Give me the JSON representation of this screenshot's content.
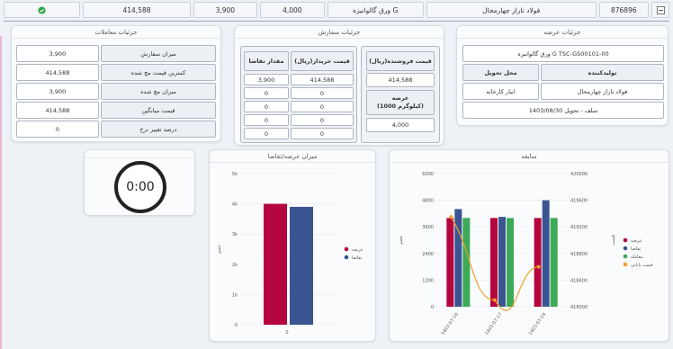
{
  "topbar": {
    "collapse_icon": "minus-box-icon",
    "code": "876896",
    "producer": "فولاد تاراز چهارمحال",
    "product": "ورق گالوانیزه G",
    "volume": "4,000",
    "qty": "3,900",
    "price": "414,588",
    "status_icon": "check-circle-icon",
    "status_color": "#28a745"
  },
  "supply": {
    "title": "جزئیات عرضه",
    "product_name": "ورق گالوانیزه G TSC-GS00101-00",
    "producer_label": "تولیدکننده",
    "delivery_label": "محل تحویل",
    "producer_value": "فولاد تاراز چهارمحال",
    "delivery_value": "انبار کارخانه",
    "settlement": "سلف - تحویل 1403/08/30"
  },
  "order": {
    "title": "جزئیات سفارش",
    "seller_price_header": "قیمت فروشنده(ریال)",
    "seller_price": "414,588",
    "supply_header": "عرضه\n(1000 کیلوگرم)",
    "supply_value": "4,000",
    "buyer_price_header": "قیمت خریدار(ریال)",
    "demand_header": "مقدار تقاضا",
    "rows": [
      {
        "price": "414,588",
        "qty": "3,900"
      },
      {
        "price": "0",
        "qty": "0"
      },
      {
        "price": "0",
        "qty": "0"
      },
      {
        "price": "0",
        "qty": "0"
      },
      {
        "price": "0",
        "qty": "0"
      }
    ]
  },
  "trades": {
    "title": "جزئیات معاملات",
    "rows": [
      {
        "label": "میزان سفارش",
        "value": "3,900"
      },
      {
        "label": "کمترین قیمت مچ شده",
        "value": "414,588"
      },
      {
        "label": "میزان مچ شده",
        "value": "3,900"
      },
      {
        "label": "قیمت میانگین",
        "value": "414,588"
      },
      {
        "label": "درصد تغییر نرخ",
        "value": "0"
      }
    ]
  },
  "timer": {
    "value": "0:00"
  },
  "supply_demand_chart": {
    "title": "میزان عرضه/تقاضا",
    "ylabel": "حجم",
    "yticks": [
      "5k",
      "4k",
      "3k",
      "2k",
      "1k",
      "0"
    ],
    "xtick": "0",
    "legend": [
      "عرضه",
      "تقاضا"
    ]
  },
  "history_chart": {
    "title": "سابقه",
    "left_ticks": [
      "6000",
      "4800",
      "3600",
      "2400",
      "1200",
      "0"
    ],
    "right_ticks": [
      "420000",
      "419600",
      "419200",
      "418800",
      "418400",
      "418000"
    ],
    "left_label": "حجم",
    "right_label": "قیمت",
    "dates": [
      "1403-07-16",
      "1403-07-17",
      "1403-07-24"
    ],
    "legend": [
      "عرضه",
      "تقاضا",
      "معامله",
      "قیمت پایانی"
    ]
  },
  "colors": {
    "supply": "#b5053f",
    "demand": "#3a5592",
    "trade": "#3daa57",
    "price": "#f0a02a"
  },
  "chart_data": [
    {
      "type": "bar",
      "title": "میزان عرضه/تقاضا",
      "ylabel": "حجم",
      "categories": [
        "0"
      ],
      "series": [
        {
          "name": "عرضه",
          "values": [
            4000
          ]
        },
        {
          "name": "تقاضا",
          "values": [
            3900
          ]
        }
      ],
      "ylim": [
        0,
        5000
      ],
      "legend": "right"
    },
    {
      "type": "bar",
      "title": "سابقه",
      "categories": [
        "1403-07-16",
        "1403-07-17",
        "1403-07-24"
      ],
      "series": [
        {
          "name": "عرضه",
          "values": [
            4000,
            4000,
            4000
          ]
        },
        {
          "name": "تقاضا",
          "values": [
            4400,
            4050,
            4800
          ]
        },
        {
          "name": "معامله",
          "values": [
            4000,
            4000,
            4000
          ]
        },
        {
          "name": "قیمت پایانی",
          "type": "line",
          "axis": "right",
          "values": [
            419350,
            418100,
            418600
          ]
        }
      ],
      "ylim": [
        0,
        6000
      ],
      "y2lim": [
        418000,
        420000
      ],
      "legend": "right"
    }
  ]
}
